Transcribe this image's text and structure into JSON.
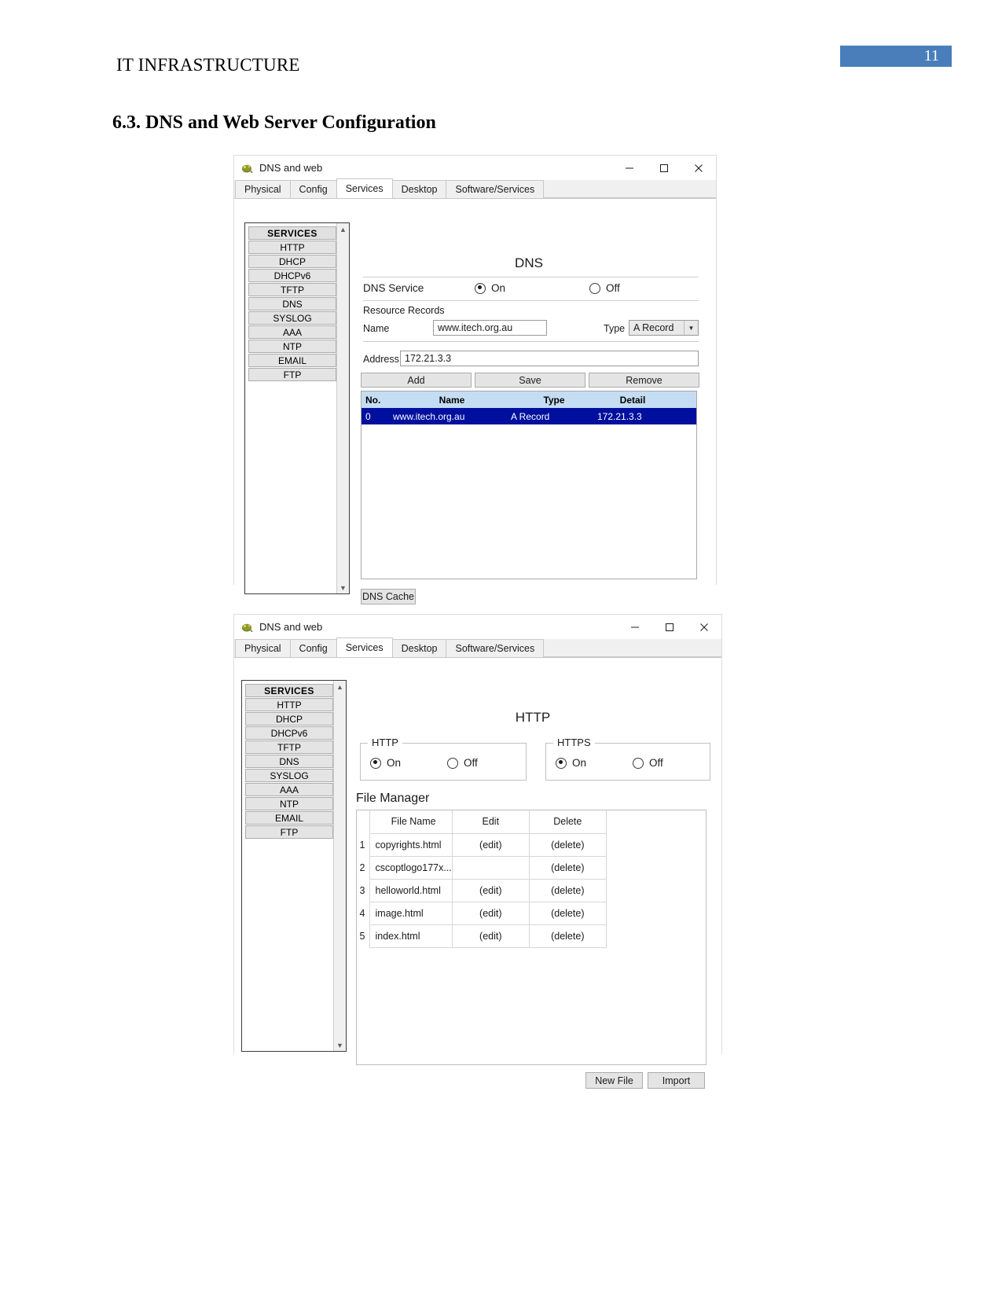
{
  "document": {
    "header_title": "IT INFRASTRUCTURE",
    "page_number": "11",
    "section_heading": "6.3. DNS and Web Server Configuration",
    "accent_color": "#4a7ebb"
  },
  "window_dns": {
    "title": "DNS and web",
    "icon": "packet-tracer-device-icon",
    "controls": {
      "minimize": "minimize-icon",
      "maximize": "maximize-icon",
      "close": "close-icon"
    },
    "tabs": [
      {
        "label": "Physical",
        "active": false
      },
      {
        "label": "Config",
        "active": false
      },
      {
        "label": "Services",
        "active": true
      },
      {
        "label": "Desktop",
        "active": false
      },
      {
        "label": "Software/Services",
        "active": false
      }
    ],
    "sidebar": {
      "header": "SERVICES",
      "items": [
        {
          "label": "HTTP"
        },
        {
          "label": "DHCP"
        },
        {
          "label": "DHCPv6"
        },
        {
          "label": "TFTP"
        },
        {
          "label": "DNS"
        },
        {
          "label": "SYSLOG"
        },
        {
          "label": "AAA"
        },
        {
          "label": "NTP"
        },
        {
          "label": "EMAIL"
        },
        {
          "label": "FTP"
        }
      ]
    },
    "panel": {
      "title": "DNS",
      "service_label": "DNS Service",
      "on_label": "On",
      "off_label": "Off",
      "service_state": "On",
      "resource_records_label": "Resource Records",
      "name_label": "Name",
      "name_value": "www.itech.org.au",
      "type_label": "Type",
      "type_value": "A Record",
      "address_label": "Address",
      "address_value": "172.21.3.3",
      "buttons": {
        "add": "Add",
        "save": "Save",
        "remove": "Remove",
        "dns_cache": "DNS Cache"
      },
      "table": {
        "columns": [
          "No.",
          "Name",
          "Type",
          "Detail"
        ],
        "rows": [
          {
            "no": "0",
            "name": "www.itech.org.au",
            "type": "A Record",
            "detail": "172.21.3.3",
            "selected": true
          }
        ]
      }
    }
  },
  "window_http": {
    "title": "DNS and web",
    "icon": "packet-tracer-device-icon",
    "controls": {
      "minimize": "minimize-icon",
      "maximize": "maximize-icon",
      "close": "close-icon"
    },
    "tabs": [
      {
        "label": "Physical",
        "active": false
      },
      {
        "label": "Config",
        "active": false
      },
      {
        "label": "Services",
        "active": true
      },
      {
        "label": "Desktop",
        "active": false
      },
      {
        "label": "Software/Services",
        "active": false
      }
    ],
    "sidebar": {
      "header": "SERVICES",
      "items": [
        {
          "label": "HTTP"
        },
        {
          "label": "DHCP"
        },
        {
          "label": "DHCPv6"
        },
        {
          "label": "TFTP"
        },
        {
          "label": "DNS"
        },
        {
          "label": "SYSLOG"
        },
        {
          "label": "AAA"
        },
        {
          "label": "NTP"
        },
        {
          "label": "EMAIL"
        },
        {
          "label": "FTP"
        }
      ]
    },
    "panel": {
      "title": "HTTP",
      "http_group_label": "HTTP",
      "https_group_label": "HTTPS",
      "on_label": "On",
      "off_label": "Off",
      "http_state": "On",
      "https_state": "On",
      "file_manager_label": "File Manager",
      "table": {
        "columns": [
          "File Name",
          "Edit",
          "Delete"
        ],
        "rows": [
          {
            "index": "1",
            "file_name": "copyrights.html",
            "edit": "(edit)",
            "delete": "(delete)"
          },
          {
            "index": "2",
            "file_name": "cscoptlogo177x...",
            "edit": "",
            "delete": "(delete)"
          },
          {
            "index": "3",
            "file_name": "helloworld.html",
            "edit": "(edit)",
            "delete": "(delete)"
          },
          {
            "index": "4",
            "file_name": "image.html",
            "edit": "(edit)",
            "delete": "(delete)"
          },
          {
            "index": "5",
            "file_name": "index.html",
            "edit": "(edit)",
            "delete": "(delete)"
          }
        ]
      },
      "buttons": {
        "new_file": "New File",
        "import": "Import"
      }
    }
  }
}
